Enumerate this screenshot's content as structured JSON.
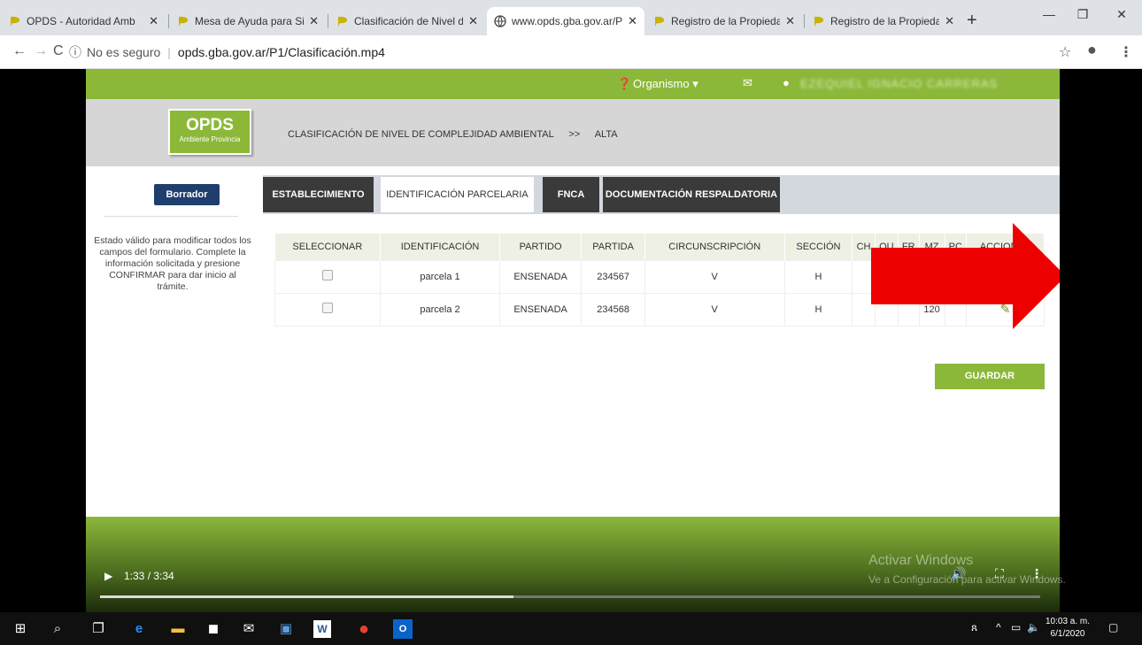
{
  "browser": {
    "tabs": [
      {
        "title": "OPDS - Autoridad Amb",
        "active": false
      },
      {
        "title": "Mesa de Ayuda para Si",
        "active": false
      },
      {
        "title": "Clasificación de Nivel d",
        "active": false
      },
      {
        "title": "www.opds.gba.gov.ar/P",
        "active": true
      },
      {
        "title": "Registro de la Propieda",
        "active": false
      },
      {
        "title": "Registro de la Propieda",
        "active": false
      }
    ],
    "security_label": "No es seguro",
    "url": "opds.gba.gov.ar/P1/Clasificación.mp4"
  },
  "app": {
    "topbar": {
      "organismo": "Organismo",
      "user": "EZEQUIEL IGNACIO CARRERAS"
    },
    "logo": {
      "big": "OPDS",
      "small": "Ambiente Provincia"
    },
    "breadcrumb": {
      "section": "CLASIFICACIÓN DE NIVEL DE COMPLEJIDAD AMBIENTAL",
      "separator": ">>",
      "current": "ALTA"
    },
    "status_badge": "Borrador",
    "status_help": "Estado válido para modificar todos los campos del formulario. Complete la información solicitada y presione CONFIRMAR para dar inicio al trámite.",
    "tabs": [
      "ESTABLECIMIENTO",
      "IDENTIFICACIÓN PARCELARIA",
      "FNCA",
      "DOCUMENTACIÓN RESPALDATORIA"
    ],
    "active_tab": "IDENTIFICACIÓN PARCELARIA",
    "table": {
      "headers": [
        "SELECCIONAR",
        "IDENTIFICACIÓN",
        "PARTIDO",
        "PARTIDA",
        "CIRCUNSCRIPCIÓN",
        "SECCIÓN",
        "CH",
        "QU",
        "FR",
        "MZ",
        "PC",
        "ACCIONES"
      ],
      "rows": [
        [
          "",
          "parcela 1",
          "ENSENADA",
          "234567",
          "V",
          "H",
          "",
          "",
          "",
          "",
          "",
          ""
        ],
        [
          "",
          "parcela 2",
          "ENSENADA",
          "234568",
          "V",
          "H",
          "",
          "",
          "",
          "120",
          "",
          ""
        ]
      ]
    },
    "save_label": "GUARDAR"
  },
  "player": {
    "time": "1:33 / 3:34",
    "progress": 0.44
  },
  "watermark": {
    "line1": "Activar Windows",
    "line2": "Ve a Configuración para activar Windows."
  },
  "taskbar": {
    "time": "10:03 a. m.",
    "date": "6/1/2020"
  },
  "colors": {
    "accent_green": "#8cb83a",
    "badge_blue": "#1f3e6e",
    "highlight_red": "#e00000"
  }
}
